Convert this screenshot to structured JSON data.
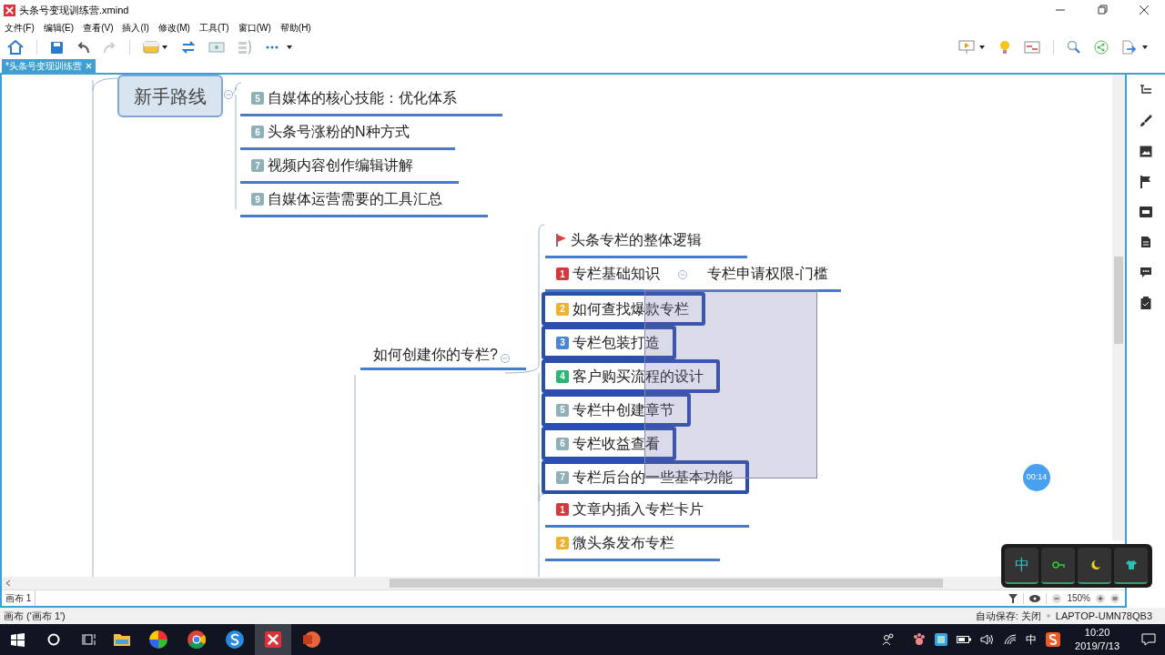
{
  "window": {
    "title": "头条号变现训练营.xmind"
  },
  "menu": [
    "文件(F)",
    "编辑(E)",
    "查看(V)",
    "插入(I)",
    "修改(M)",
    "工具(T)",
    "窗口(W)",
    "帮助(H)"
  ],
  "tabs": [
    {
      "label": "*头条号变现训练营",
      "selected": true
    }
  ],
  "map": {
    "branches": [
      {
        "topic": "新手路线",
        "subtopics": [
          {
            "text": "自媒体的核心技能：优化体系",
            "marker": {
              "kind": "number",
              "label": "5",
              "color": "#8fb0b8"
            },
            "selected": false
          },
          {
            "text": "头条号涨粉的N种方式",
            "marker": {
              "kind": "number",
              "label": "6",
              "color": "#8fb0b8"
            },
            "selected": false
          },
          {
            "text": "视频内容创作编辑讲解",
            "marker": {
              "kind": "number",
              "label": "7",
              "color": "#8fb0b8"
            },
            "selected": false
          },
          {
            "text": "自媒体运营需要的工具汇总",
            "marker": {
              "kind": "number",
              "label": "9",
              "color": "#8fb0b8"
            },
            "selected": false
          }
        ]
      },
      {
        "topic": "如何创建你的专栏?",
        "subtopics": [
          {
            "text": "头条专栏的整体逻辑",
            "marker": {
              "kind": "flag",
              "color": "#e0403a"
            },
            "selected": false
          },
          {
            "text": "专栏基础知识",
            "marker": {
              "kind": "number",
              "label": "1",
              "color": "#d9363e"
            },
            "selected": false,
            "children": [
              {
                "text": "专栏申请权限-门槛"
              }
            ]
          },
          {
            "text": "如何查找爆款专栏",
            "marker": {
              "kind": "number",
              "label": "2",
              "color": "#f0b030"
            },
            "selected": true
          },
          {
            "text": "专栏包装打造",
            "marker": {
              "kind": "number",
              "label": "3",
              "color": "#4a86d8"
            },
            "selected": true
          },
          {
            "text": "客户购买流程的设计",
            "marker": {
              "kind": "number",
              "label": "4",
              "color": "#2bb673"
            },
            "selected": true
          },
          {
            "text": "专栏中创建章节",
            "marker": {
              "kind": "number",
              "label": "5",
              "color": "#8fb0b8"
            },
            "selected": true
          },
          {
            "text": "专栏收益查看",
            "marker": {
              "kind": "number",
              "label": "6",
              "color": "#8fb0b8"
            },
            "selected": true
          },
          {
            "text": "专栏后台的一些基本功能",
            "marker": {
              "kind": "number",
              "label": "7",
              "color": "#8fb0b8"
            },
            "selected": true
          }
        ]
      },
      {
        "subtopics": [
          {
            "text": "文章内插入专栏卡片",
            "marker": {
              "kind": "number",
              "label": "1",
              "color": "#d9363e"
            },
            "selected": false
          },
          {
            "text": "微头条发布专栏",
            "marker": {
              "kind": "number",
              "label": "2",
              "color": "#f0b030"
            },
            "selected": false
          }
        ]
      }
    ]
  },
  "recording_badge": "00:14",
  "ime_toolbar": [
    {
      "kind": "text",
      "label": "中"
    },
    {
      "kind": "key"
    },
    {
      "kind": "moon"
    },
    {
      "kind": "shirt"
    }
  ],
  "sheet_tabs": [
    {
      "label": "画布 1",
      "selected": true
    }
  ],
  "zoom": {
    "value": "150%"
  },
  "status_bar": {
    "left": "画布 ('画布 1')",
    "autosave": "自动保存: 关闭",
    "computer": "LAPTOP-UMN78QB3"
  },
  "taskbar": {
    "time": "10:20",
    "date": "2019/7/13",
    "ime": "中"
  }
}
